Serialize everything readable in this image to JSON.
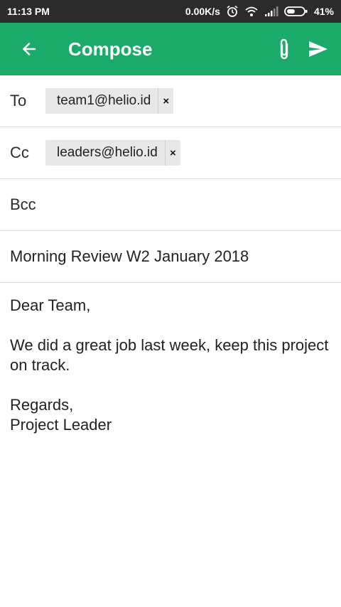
{
  "status_bar": {
    "time": "11:13 PM",
    "net_speed": "0.00K/s",
    "battery": "41%",
    "icons": [
      "alarm-icon",
      "wifi-icon",
      "signal-icon",
      "battery-icon"
    ]
  },
  "app_bar": {
    "title": "Compose",
    "color": "#1aaa6a",
    "icons": [
      "back-arrow-icon",
      "paperclip-icon",
      "send-icon"
    ]
  },
  "to": {
    "label": "To",
    "chip": "team1@helio.id",
    "chip_close": "×"
  },
  "cc": {
    "label": "Cc",
    "chip": "leaders@helio.id",
    "chip_close": "×"
  },
  "bcc": {
    "label": "Bcc"
  },
  "subject": "Morning Review W2 January 2018",
  "body": {
    "greeting": "Dear Team,",
    "message": "We did a great job last week, keep this project on track.",
    "closing": "Regards,",
    "signature": "Project Leader"
  }
}
